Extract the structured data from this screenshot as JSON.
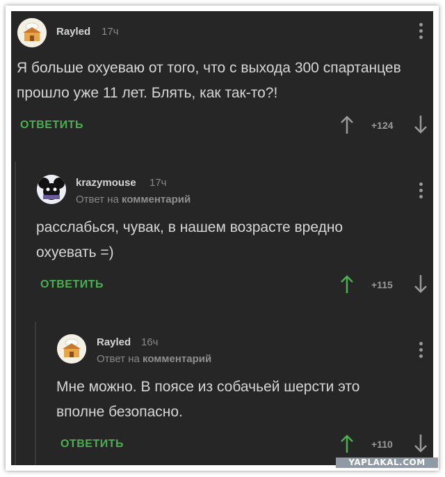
{
  "comments": [
    {
      "username": "Rayled",
      "time": "17ч",
      "text_line1": "Я больше охуеваю от того, что с выхода 300 спартанцев",
      "text_line2": "прошло уже 11 лет. Блять, как так-то?!",
      "reply_label": "ОТВЕТИТЬ",
      "score": "+124",
      "upvoted": false
    },
    {
      "username": "krazymouse",
      "time": "17ч",
      "reply_prefix": "Ответ на",
      "reply_target": "комментарий",
      "text_line1": "расслабься, чувак, в нашем возрасте вредно",
      "text_line2": "охуевать =)",
      "reply_label": "ОТВЕТИТЬ",
      "score": "+115",
      "upvoted": true
    },
    {
      "username": "Rayled",
      "time": "16ч",
      "reply_prefix": "Ответ на",
      "reply_target": "комментарий",
      "text_line1": "Мне можно. В поясе из собачьей шерсти это",
      "text_line2": "вполне безопасно.",
      "reply_label": "ОТВЕТИТЬ",
      "score": "+110",
      "upvoted": true
    }
  ],
  "colors": {
    "background": "#262626",
    "accent_green": "#4caf50",
    "text": "#d6d6d6",
    "muted": "#8a8a8a"
  },
  "watermark": "YAPLAKAL.COM"
}
